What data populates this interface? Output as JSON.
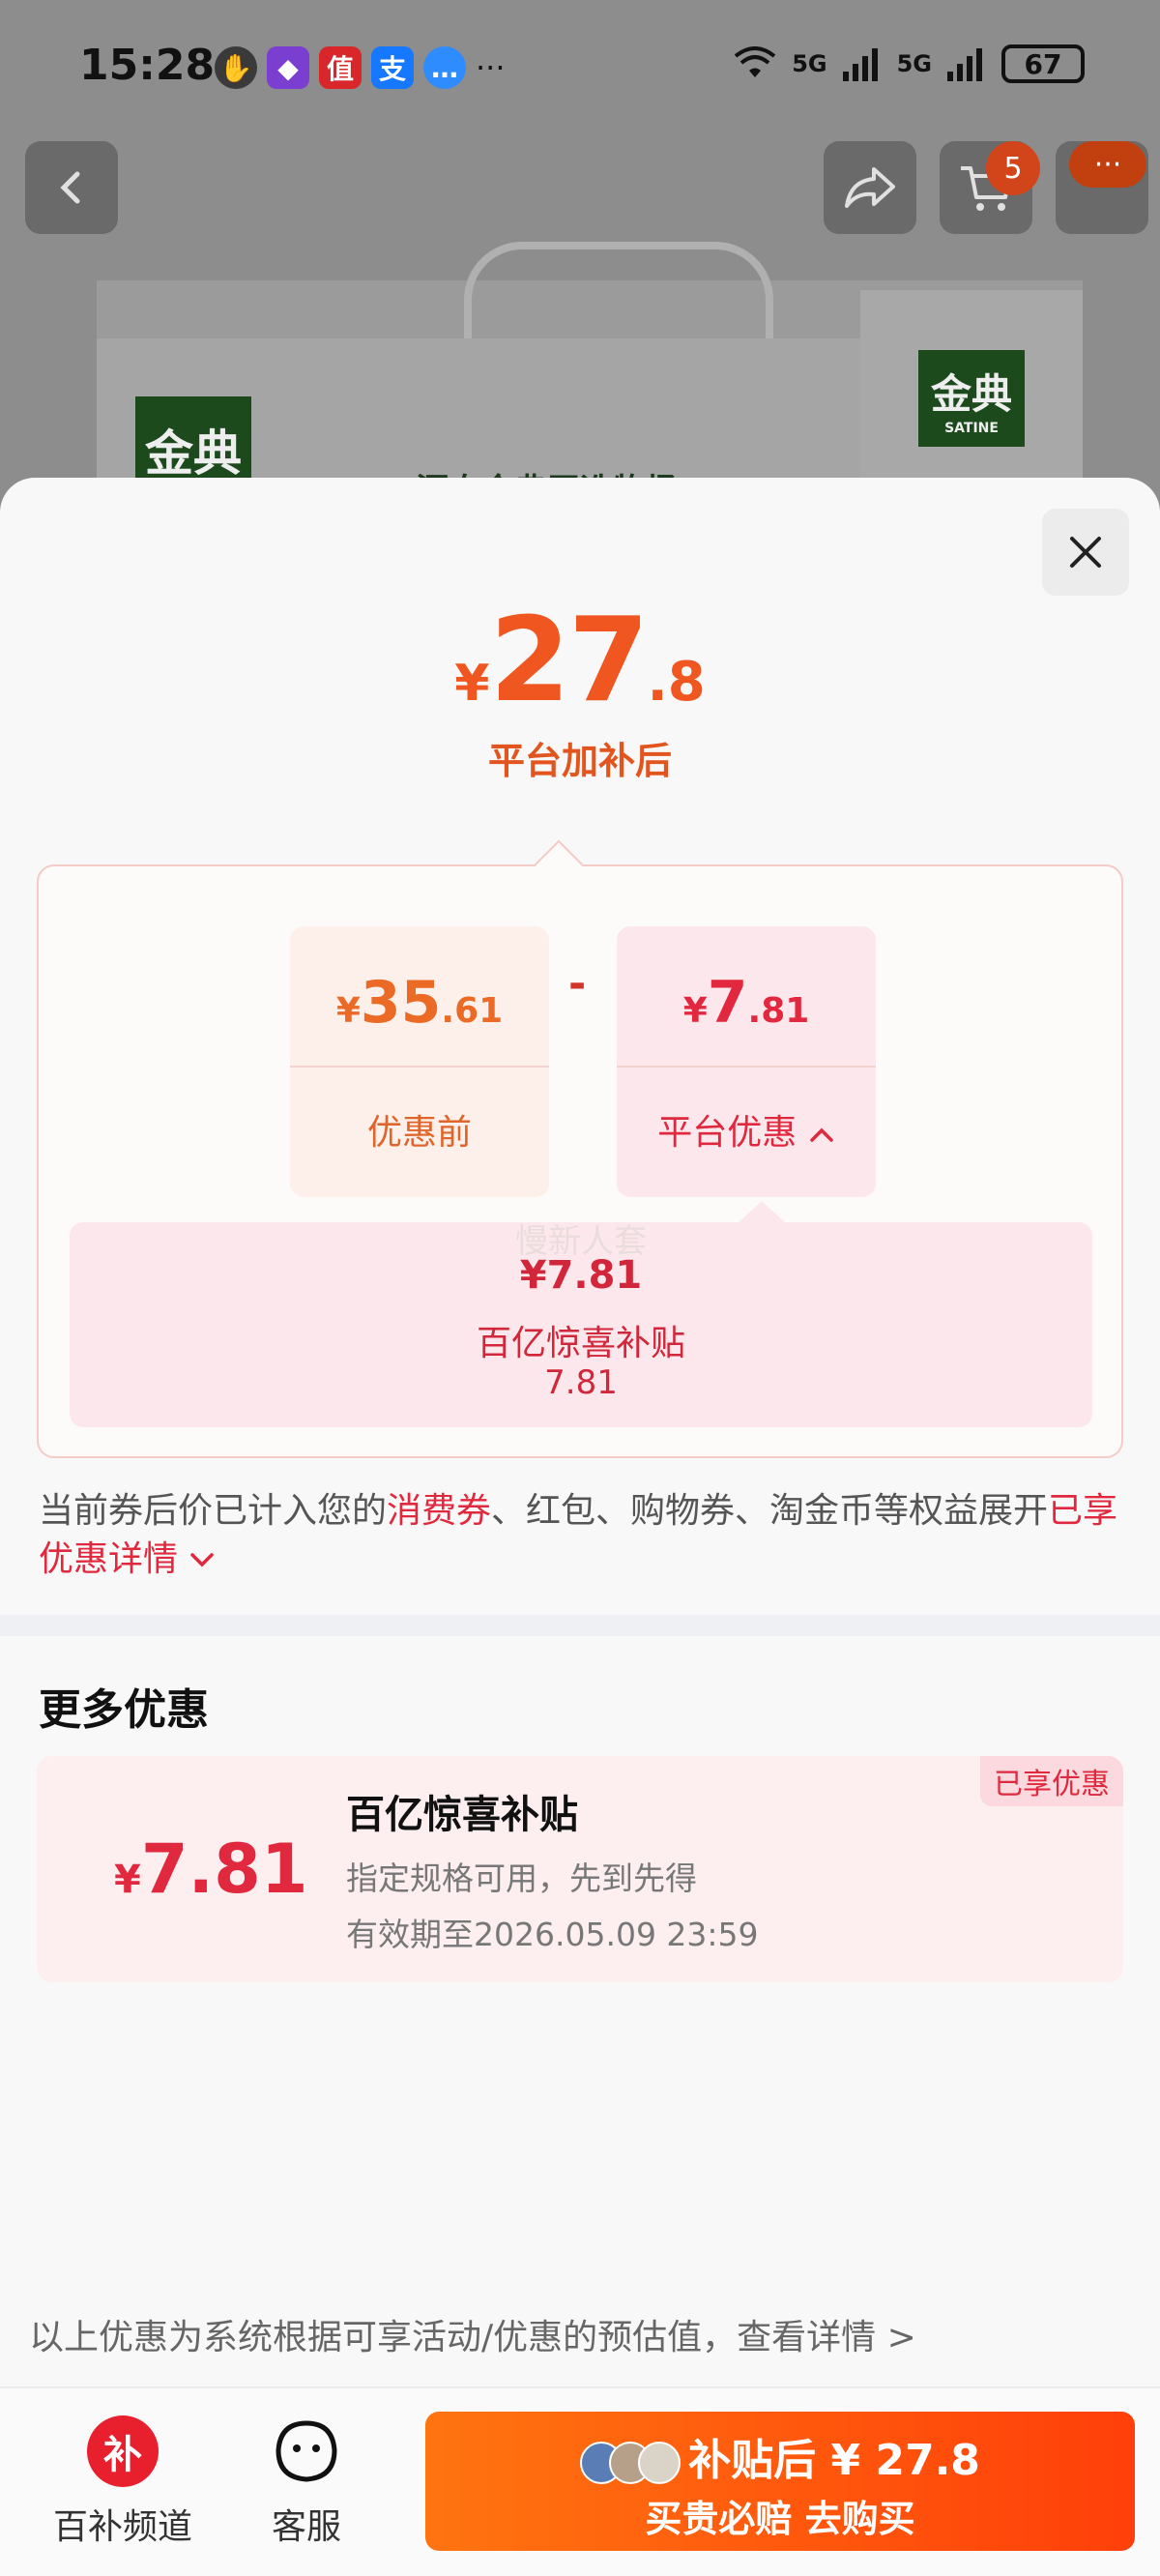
{
  "status_bar": {
    "time": "15:28",
    "network1": "5G",
    "network2": "5G",
    "battery": "67",
    "more": "···"
  },
  "header": {
    "cart_count": "5",
    "more_label": "···"
  },
  "product": {
    "brand": "金典",
    "brand_en": "SATINE",
    "slogan": "源自金典严选牧场"
  },
  "price_sheet": {
    "final_yen": "¥",
    "final_int": "27",
    "final_dec": ".8",
    "final_caption": "平台加补后",
    "before": {
      "yen": "¥",
      "int": "35",
      "dec": ".61",
      "label": "优惠前"
    },
    "minus": "-",
    "discount": {
      "yen": "¥",
      "int": "7",
      "dec": ".81",
      "label": "平台优惠"
    },
    "subsidy": {
      "ghost_text": "慢新人套",
      "amount": "¥7.81",
      "name": "百亿惊喜补贴",
      "value": "7.81"
    },
    "note_prefix": "当前券后价已计入您的",
    "note_highlight": "消费券",
    "note_middle": "、红包、购物券、淘金币等权益展开",
    "note_link": "已享优惠详情"
  },
  "more_offers": {
    "title": "更多优惠",
    "coupon": {
      "tag": "已享优惠",
      "yen": "¥",
      "value": "7.81",
      "name": "百亿惊喜补贴",
      "desc": "指定规格可用，先到先得",
      "expiry": "有效期至2026.05.09 23:59"
    }
  },
  "disclaimer": "以上优惠为系统根据可享活动/优惠的预估值，查看详情 >",
  "bottom_bar": {
    "channel_icon_text": "补",
    "channel_label": "百补频道",
    "service_label": "客服",
    "buy_top": "补贴后 ¥ 27.8",
    "buy_bottom": "买贵必赔  去购买"
  },
  "colors": {
    "accent_orange": "#f0561f",
    "accent_red": "#e0283e",
    "buy_gradient_start": "#ff7410",
    "buy_gradient_end": "#ff3f0a"
  }
}
